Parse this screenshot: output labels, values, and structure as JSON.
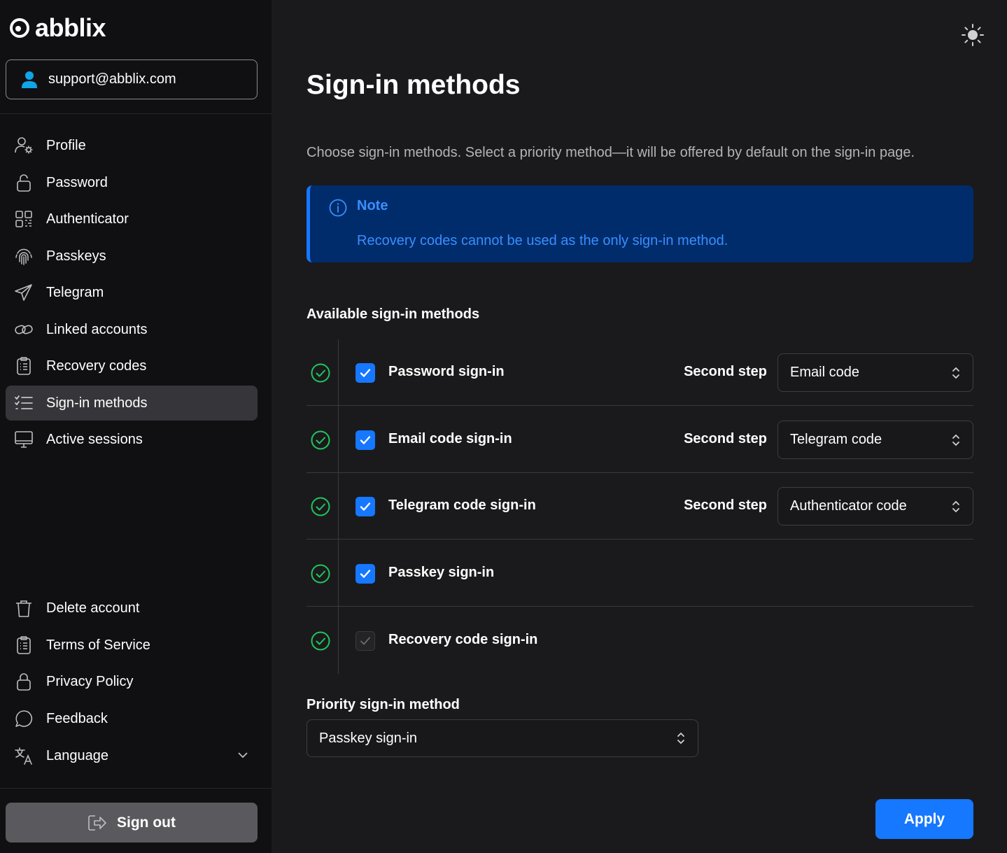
{
  "brand": {
    "name": "abblix"
  },
  "user": {
    "email": "support@abblix.com"
  },
  "sidebar": {
    "items": [
      {
        "label": "Profile",
        "icon": "user-gear-icon"
      },
      {
        "label": "Password",
        "icon": "lock-icon"
      },
      {
        "label": "Authenticator",
        "icon": "qr-code-icon"
      },
      {
        "label": "Passkeys",
        "icon": "fingerprint-icon"
      },
      {
        "label": "Telegram",
        "icon": "send-icon"
      },
      {
        "label": "Linked accounts",
        "icon": "link-icon"
      },
      {
        "label": "Recovery codes",
        "icon": "clipboard-list-icon"
      },
      {
        "label": "Sign-in methods",
        "icon": "list-checks-icon",
        "active": true
      },
      {
        "label": "Active sessions",
        "icon": "monitor-icon"
      }
    ],
    "bottom_items": [
      {
        "label": "Delete account",
        "icon": "trash-icon"
      },
      {
        "label": "Terms of Service",
        "icon": "clipboard-list-icon"
      },
      {
        "label": "Privacy Policy",
        "icon": "lock-icon"
      },
      {
        "label": "Feedback",
        "icon": "message-circle-icon"
      },
      {
        "label": "Language",
        "icon": "translate-icon"
      }
    ],
    "sign_out": "Sign out"
  },
  "main": {
    "title": "Sign-in methods",
    "description": "Choose sign-in methods. Select a priority method—it will be offered by default on the sign-in page.",
    "note": {
      "title": "Note",
      "text": "Recovery codes cannot be used as the only sign-in method."
    },
    "available_title": "Available sign-in methods",
    "second_step_label": "Second step",
    "methods": [
      {
        "label": "Password sign-in",
        "checked": true,
        "second_step": "Email code"
      },
      {
        "label": "Email code sign-in",
        "checked": true,
        "second_step": "Telegram code"
      },
      {
        "label": "Telegram code sign-in",
        "checked": true,
        "second_step": "Authenticator code"
      },
      {
        "label": "Passkey sign-in",
        "checked": true
      },
      {
        "label": "Recovery code sign-in",
        "checked": true,
        "disabled": true
      }
    ],
    "priority_label": "Priority sign-in method",
    "priority_value": "Passkey sign-in",
    "apply": "Apply"
  },
  "colors": {
    "accent": "#1677ff",
    "success": "#22c55e",
    "note_bg": "#002c6b",
    "note_text": "#3a8eff"
  }
}
